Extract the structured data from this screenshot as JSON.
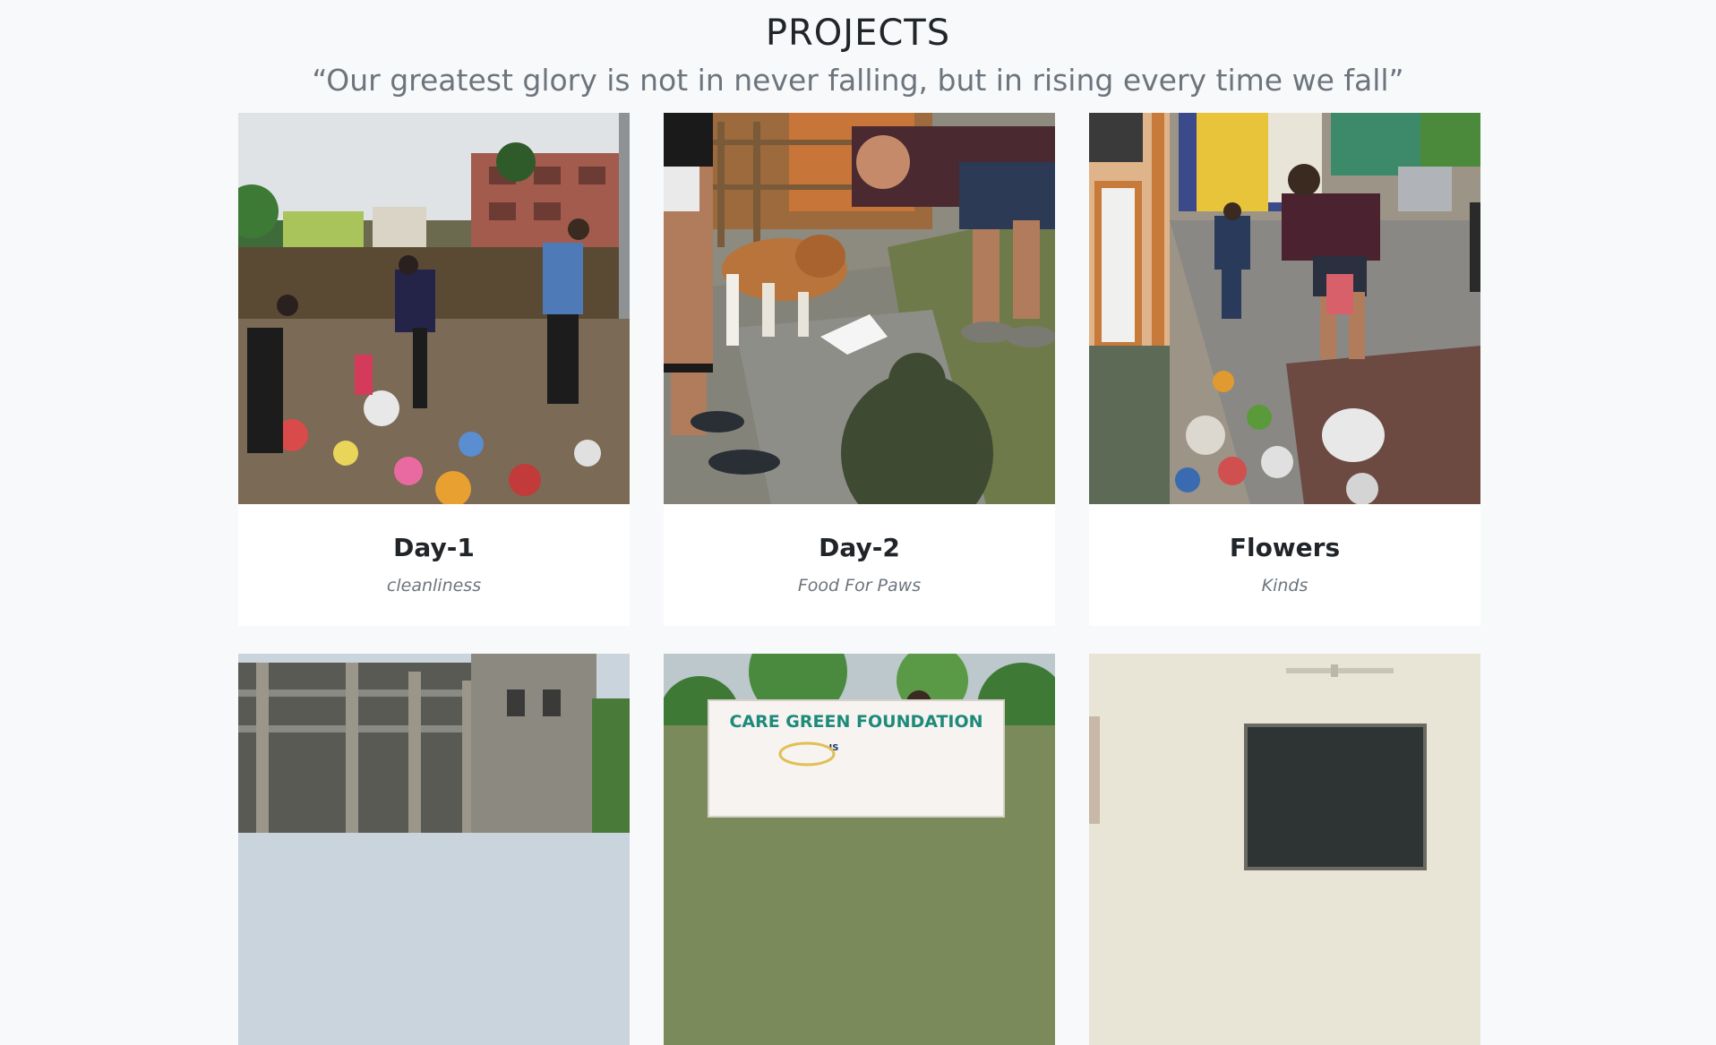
{
  "section": {
    "title": "PROJECTS",
    "quote": "“Our greatest glory is not in never falling, but in rising every time we fall”"
  },
  "projects": [
    {
      "title": "Day-1",
      "subtitle": "cleanliness",
      "image": "cleanup-garbage-dump-photo"
    },
    {
      "title": "Day-2",
      "subtitle": "Food For Paws",
      "image": "feeding-dog-photo"
    },
    {
      "title": "Flowers",
      "subtitle": "Kinds",
      "image": "roadside-cleanup-photo"
    },
    {
      "title": "",
      "subtitle": "",
      "image": "unfinished-building-photo"
    },
    {
      "title": "",
      "subtitle": "",
      "image": "banner-photo",
      "banner_text": "CARE GREEN FOUNDATION",
      "banner_small": "IS"
    },
    {
      "title": "",
      "subtitle": "",
      "image": "classroom-blackboard-photo"
    }
  ],
  "colors": {
    "page_background": "#f8f9fa",
    "card_background": "#ffffff",
    "heading": "#212529",
    "muted": "#6c757d",
    "banner_text": "#1e8a7a"
  }
}
